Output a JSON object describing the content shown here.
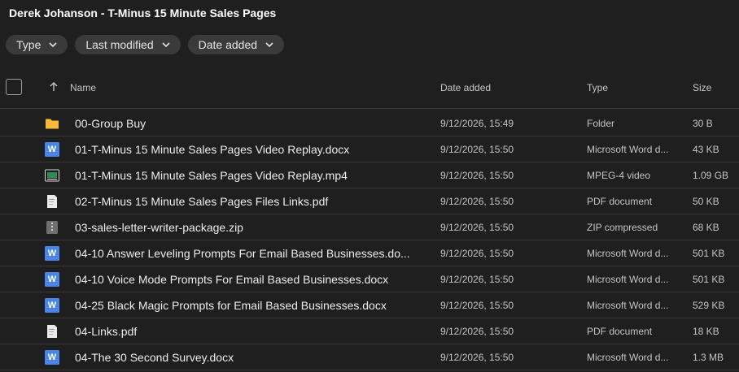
{
  "page": {
    "title": "Derek Johanson - T-Minus 15 Minute Sales Pages"
  },
  "filters": [
    {
      "label": "Type"
    },
    {
      "label": "Last modified"
    },
    {
      "label": "Date added"
    }
  ],
  "columns": {
    "name": "Name",
    "date_added": "Date added",
    "type": "Type",
    "size": "Size"
  },
  "files": [
    {
      "icon": "folder-icon",
      "name": "00-Group Buy",
      "date": "9/12/2026, 15:49",
      "type": "Folder",
      "size": "30 B"
    },
    {
      "icon": "word-doc-icon",
      "name": "01-T-Minus 15 Minute Sales Pages Video Replay.docx",
      "date": "9/12/2026, 15:50",
      "type": "Microsoft Word d...",
      "size": "43 KB"
    },
    {
      "icon": "video-file-icon",
      "name": "01-T-Minus 15 Minute Sales Pages Video Replay.mp4",
      "date": "9/12/2026, 15:50",
      "type": "MPEG-4 video",
      "size": "1.09 GB"
    },
    {
      "icon": "pdf-file-icon",
      "name": "02-T-Minus 15 Minute Sales Pages Files Links.pdf",
      "date": "9/12/2026, 15:50",
      "type": "PDF document",
      "size": "50 KB"
    },
    {
      "icon": "zip-file-icon",
      "name": "03-sales-letter-writer-package.zip",
      "date": "9/12/2026, 15:50",
      "type": "ZIP compressed",
      "size": "68 KB"
    },
    {
      "icon": "word-doc-icon",
      "name": "04-10 Answer Leveling Prompts For Email Based Businesses.do...",
      "date": "9/12/2026, 15:50",
      "type": "Microsoft Word d...",
      "size": "501 KB"
    },
    {
      "icon": "word-doc-icon",
      "name": "04-10 Voice Mode Prompts For Email Based Businesses.docx",
      "date": "9/12/2026, 15:50",
      "type": "Microsoft Word d...",
      "size": "501 KB"
    },
    {
      "icon": "word-doc-icon",
      "name": "04-25 Black Magic Prompts for Email Based Businesses.docx",
      "date": "9/12/2026, 15:50",
      "type": "Microsoft Word d...",
      "size": "529 KB"
    },
    {
      "icon": "pdf-file-icon",
      "name": "04-Links.pdf",
      "date": "9/12/2026, 15:50",
      "type": "PDF document",
      "size": "18 KB"
    },
    {
      "icon": "word-doc-icon",
      "name": "04-The 30 Second Survey.docx",
      "date": "9/12/2026, 15:50",
      "type": "Microsoft Word d...",
      "size": "1.3 MB"
    }
  ],
  "colors": {
    "background": "#1f1f1f",
    "chip": "#3a3a3a",
    "word_blue": "#4a86e8",
    "folder_yellow": "#f6b93b",
    "divider": "#363636"
  }
}
